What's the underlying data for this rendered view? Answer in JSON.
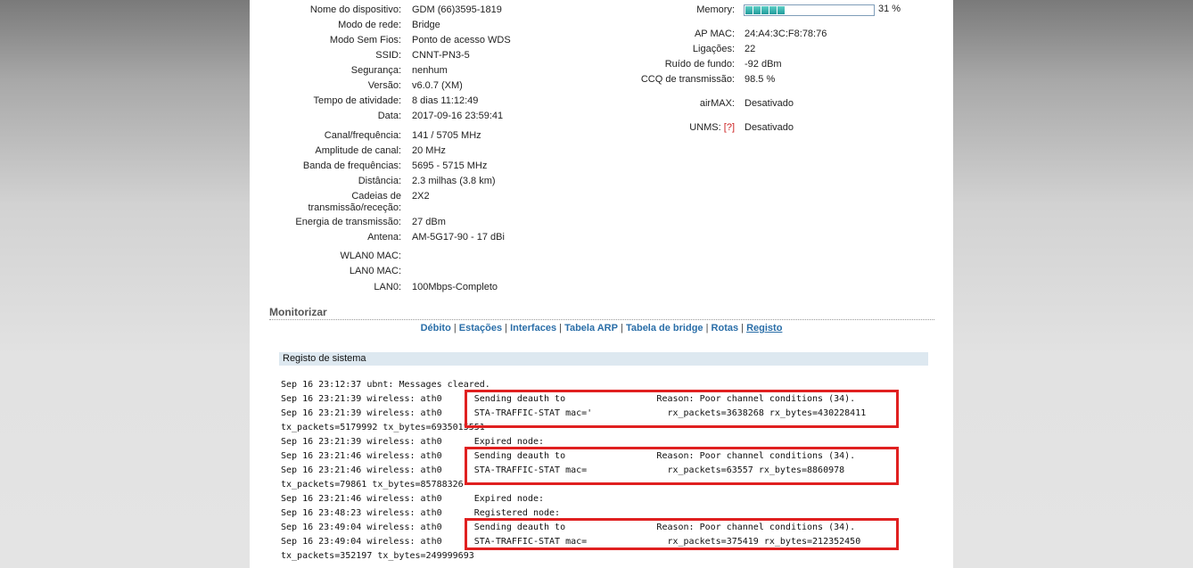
{
  "device_info_left": [
    {
      "label": "Nome do dispositivo:",
      "value": "GDM (66)3595-1819"
    },
    {
      "label": "Modo de rede:",
      "value": "Bridge"
    },
    {
      "label": "Modo Sem Fios:",
      "value": "Ponto de acesso WDS"
    },
    {
      "label": "SSID:",
      "value": "CNNT-PN3-5"
    },
    {
      "label": "Segurança:",
      "value": "nenhum"
    },
    {
      "label": "Versão:",
      "value": "v6.0.7 (XM)"
    },
    {
      "label": "Tempo de atividade:",
      "value": "8 dias 11:12:49"
    },
    {
      "label": "Data:",
      "value": "2017-09-16 23:59:41"
    },
    {
      "label": "Canal/frequência:",
      "value": "141 / 5705 MHz"
    },
    {
      "label": "Amplitude de canal:",
      "value": "20 MHz"
    },
    {
      "label": "Banda de frequências:",
      "value": "5695 - 5715 MHz"
    },
    {
      "label": "Distância:",
      "value": "2.3 milhas (3.8 km)"
    },
    {
      "label": "Cadeias de",
      "label2": "transmissão/receção:",
      "value": "2X2"
    },
    {
      "label": "Energia de transmissão:",
      "value": "27 dBm"
    },
    {
      "label": "Antena:",
      "value": "AM-5G17-90 - 17 dBi"
    },
    {
      "label": "WLAN0 MAC:",
      "value": ""
    },
    {
      "label": "LAN0 MAC:",
      "value": ""
    },
    {
      "label": "LAN0:",
      "value": "100Mbps-Completo"
    }
  ],
  "memory": {
    "label": "Memory:",
    "percent_text": "31 %",
    "percent": 31
  },
  "device_info_right": [
    {
      "label": "AP MAC:",
      "value": "24:A4:3C:F8:78:76"
    },
    {
      "label": "Ligações:",
      "value": "22"
    },
    {
      "label": "Ruído de fundo:",
      "value": "-92 dBm"
    },
    {
      "label": "CCQ de transmissão:",
      "value": "98.5 %"
    },
    {
      "label": "airMAX:",
      "value": "Desativado"
    },
    {
      "label": "UNMS:",
      "help": "[?]",
      "value": "Desativado"
    }
  ],
  "monitor": {
    "title": "Monitorizar",
    "tabs": [
      "Débito",
      "Estações",
      "Interfaces",
      "Tabela ARP",
      "Tabela de bridge",
      "Rotas",
      "Registo"
    ],
    "active_tab": "Registo"
  },
  "log": {
    "header": "Registo de sistema",
    "lines": [
      "Sep 16 23:12:37 ubnt: Messages cleared.",
      "Sep 16 23:21:39 wireless: ath0      Sending deauth to                 Reason: Poor channel conditions (34).",
      "Sep 16 23:21:39 wireless: ath0      STA-TRAFFIC-STAT mac='              rx_packets=3638268 rx_bytes=430228411",
      "tx_packets=5179992 tx_bytes=6935015551",
      "Sep 16 23:21:39 wireless: ath0      Expired node:",
      "Sep 16 23:21:46 wireless: ath0      Sending deauth to                 Reason: Poor channel conditions (34).",
      "Sep 16 23:21:46 wireless: ath0      STA-TRAFFIC-STAT mac=               rx_packets=63557 rx_bytes=8860978",
      "tx_packets=79861 tx_bytes=85788326",
      "Sep 16 23:21:46 wireless: ath0      Expired node:",
      "Sep 16 23:48:23 wireless: ath0      Registered node:",
      "Sep 16 23:49:04 wireless: ath0      Sending deauth to                 Reason: Poor channel conditions (34).",
      "Sep 16 23:49:04 wireless: ath0      STA-TRAFFIC-STAT mac=               rx_packets=375419 rx_bytes=212352450",
      "tx_packets=352197 tx_bytes=249999693"
    ]
  }
}
